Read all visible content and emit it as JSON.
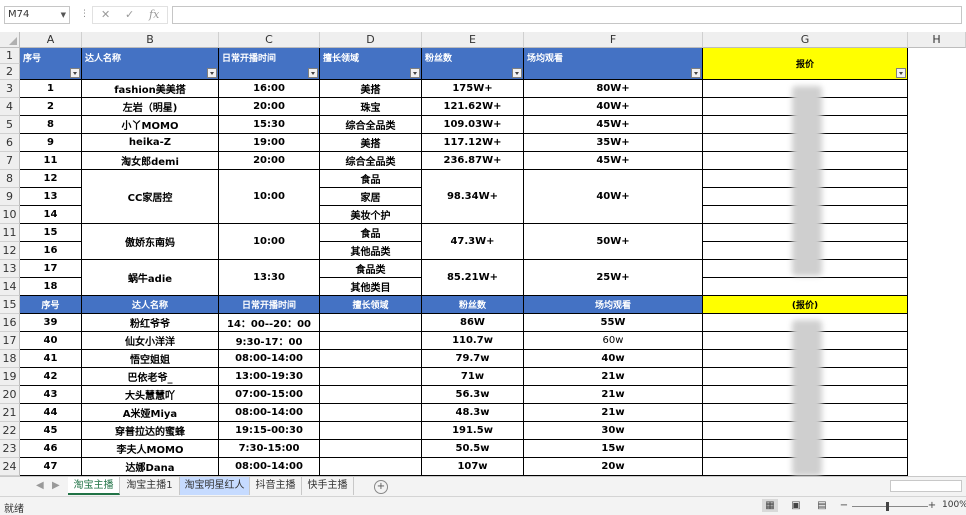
{
  "formula_bar": {
    "name_box": "M74",
    "formula": ""
  },
  "columns": [
    "A",
    "B",
    "C",
    "D",
    "E",
    "F",
    "G",
    "H"
  ],
  "rows": [
    "1",
    "2",
    "3",
    "4",
    "5",
    "6",
    "7",
    "8",
    "9",
    "10",
    "11",
    "12",
    "13",
    "14",
    "15",
    "16",
    "17",
    "18",
    "19",
    "20",
    "21",
    "22",
    "23",
    "24"
  ],
  "header1": {
    "no": "序号",
    "name": "达人名称",
    "time": "日常开播时间",
    "field": "擅长领域",
    "fans": "粉丝数",
    "avg": "场均观看",
    "price": "报价"
  },
  "header2": {
    "no": "序号",
    "name": "达人名称",
    "time": "日常开播时间",
    "field": "擅长领域",
    "fans": "粉丝数",
    "avg": "场均观看",
    "price": "(报价)"
  },
  "table": {
    "no": [
      "1",
      "2",
      "8",
      "9",
      "11",
      "12",
      "13",
      "14",
      "15",
      "16",
      "17",
      "18",
      "39",
      "40",
      "41",
      "42",
      "43",
      "44",
      "45",
      "46",
      "47"
    ],
    "name": [
      "fashion美美搭",
      "左岩（明星)",
      "小丫MOMO",
      "heika-Z",
      "淘女郎demi",
      "CC家居控",
      "傲娇东南妈",
      "蜗牛adie",
      "粉红爷爷",
      "仙女小洋洋",
      "悟空姐姐",
      "巴依老爷_",
      "大头慧慧吖",
      "A米娅Miya",
      "穿普拉达的蜜蜂",
      "李夫人MOMO",
      "达娜Dana"
    ],
    "time": [
      "16:00",
      "20:00",
      "15:30",
      "19:00",
      "20:00",
      "10:00",
      "10:00",
      "13:30",
      "14：00--20：00",
      "9:30-17：00",
      "08:00-14:00",
      "13:00-19:30",
      "07:00-15:00",
      "08:00-14:00",
      "19:15-00:30",
      "7:30-15:00",
      "08:00-14:00"
    ],
    "field": [
      "美搭",
      "珠宝",
      "综合全品类",
      "美搭",
      "综合全品类",
      "食品",
      "家居",
      "美妆个护",
      "食品",
      "其他品类",
      "食品类",
      "其他类目"
    ],
    "fans": [
      "175W+",
      "121.62W+",
      "109.03W+",
      "117.12W+",
      "236.87W+",
      "98.34W+",
      "47.3W+",
      "85.21W+",
      "86W",
      "110.7w",
      "79.7w",
      "71w",
      "56.3w",
      "48.3w",
      "191.5w",
      "50.5w",
      "107w"
    ],
    "avg": [
      "80W+",
      "40W+",
      "45W+",
      "35W+",
      "45W+",
      "40W+",
      "50W+",
      "25W+",
      "55W",
      "60w",
      "40w",
      "21w",
      "21w",
      "21w",
      "30w",
      "15w",
      "20w"
    ]
  },
  "sheets": [
    "淘宝主播",
    "淘宝主播1",
    "淘宝明星红人",
    "抖音主播",
    "快手主播"
  ],
  "status": {
    "ready": "就绪",
    "zoom": "100%"
  }
}
